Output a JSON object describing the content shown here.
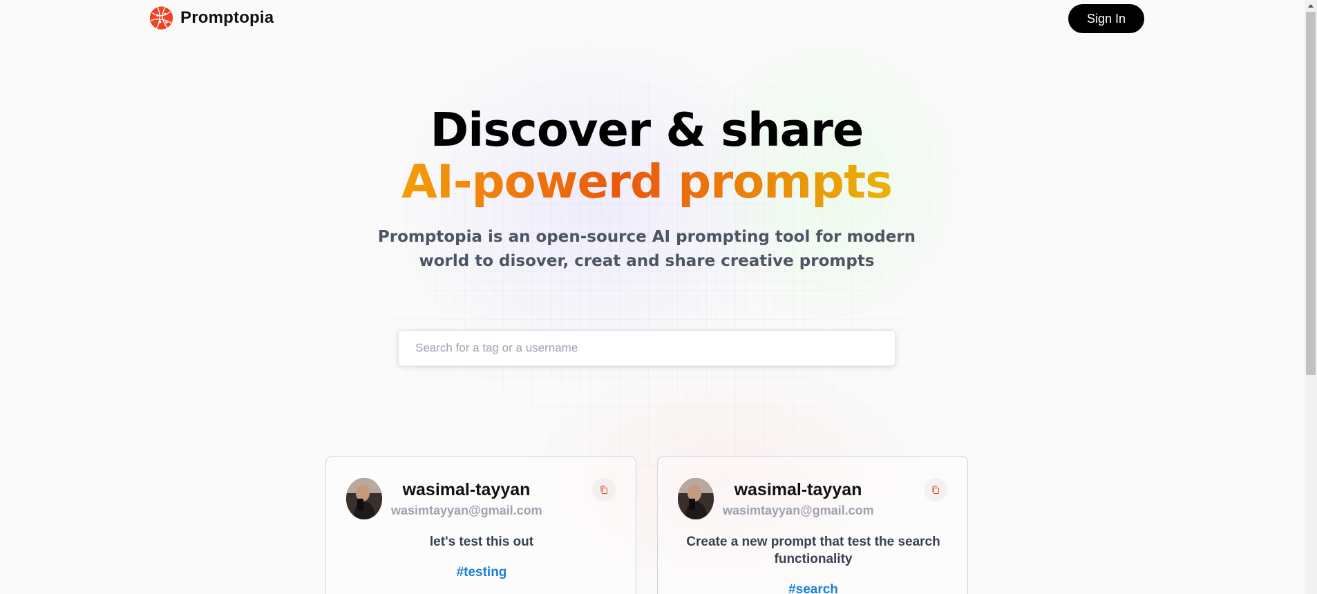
{
  "brand": {
    "name": "Promptopia",
    "logo_icon": "globe-network-icon",
    "accent": "#ef4423"
  },
  "nav": {
    "signin_label": "Sign In"
  },
  "hero": {
    "title_line1": "Discover & share",
    "title_line2": "AI-powerd prompts",
    "subtitle": "Promptopia is an open-source AI prompting tool for modern world to disover, creat and share creative prompts"
  },
  "search": {
    "placeholder": "Search for a tag or a username",
    "value": ""
  },
  "prompts": [
    {
      "username": "wasimal-tayyan",
      "email": "wasimtayyan@gmail.com",
      "text": "let's test this out",
      "tag": "#testing",
      "copy_icon": "copy-icon"
    },
    {
      "username": "wasimal-tayyan",
      "email": "wasimtayyan@gmail.com",
      "text": "Create a new prompt that test the search functionality",
      "tag": "#search",
      "copy_icon": "copy-icon"
    }
  ],
  "colors": {
    "tag": "#1d7fd6",
    "gradient": [
      "#f59e0b",
      "#ea580c",
      "#eab308"
    ]
  }
}
